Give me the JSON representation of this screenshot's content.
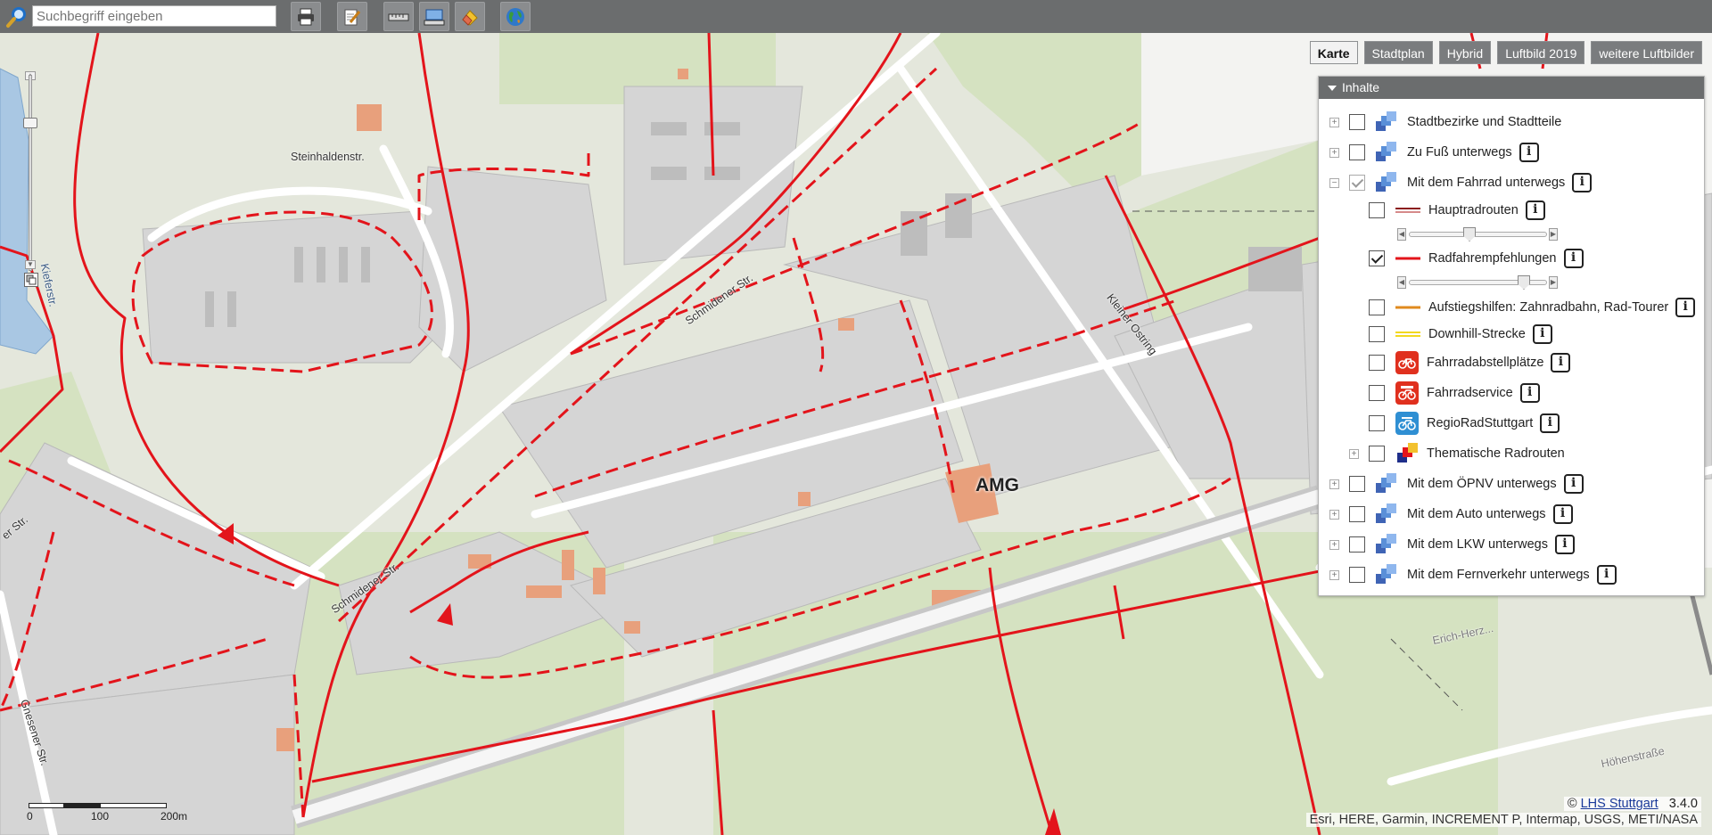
{
  "search": {
    "placeholder": "Suchbegriff eingeben"
  },
  "toolbar": {
    "buttons": [
      {
        "icon": "print-icon"
      },
      {
        "icon": "edit-icon"
      },
      {
        "icon": "measure-distance-icon"
      },
      {
        "icon": "measure-area-icon"
      },
      {
        "icon": "eraser-icon"
      },
      {
        "icon": "globe-icon"
      }
    ]
  },
  "basemaps": {
    "items": [
      "Karte",
      "Stadtplan",
      "Hybrid",
      "Luftbild 2019",
      "weitere Luftbilder"
    ],
    "active": "Karte"
  },
  "panel": {
    "title": "Inhalte",
    "layers": [
      {
        "label": "Stadtbezirke und Stadtteile",
        "checked": false,
        "expand": "+",
        "info": false
      },
      {
        "label": "Zu Fuß unterwegs",
        "checked": false,
        "expand": "+",
        "info": true
      },
      {
        "label": "Mit dem Fahrrad unterwegs",
        "checked": true,
        "expand": "−",
        "info": true
      },
      {
        "label": "Hauptradrouten",
        "checked": false,
        "info": true,
        "slider": 0.5
      },
      {
        "label": "Radfahrempfehlungen",
        "checked": true,
        "info": true,
        "slider": 0.8
      },
      {
        "label": "Aufstiegshilfen: Zahnradbahn, Rad-Tourer",
        "checked": false,
        "info": true
      },
      {
        "label": "Downhill-Strecke",
        "checked": false,
        "info": true
      },
      {
        "label": "Fahrradabstellplätze",
        "checked": false,
        "info": true
      },
      {
        "label": "Fahrradservice",
        "checked": false,
        "info": true
      },
      {
        "label": "RegioRadStuttgart",
        "checked": false,
        "info": true
      },
      {
        "label": "Thematische Radrouten",
        "checked": false,
        "expand": "+",
        "info": false
      },
      {
        "label": "Mit dem ÖPNV unterwegs",
        "checked": false,
        "expand": "+",
        "info": true
      },
      {
        "label": "Mit dem Auto unterwegs",
        "checked": false,
        "expand": "+",
        "info": true
      },
      {
        "label": "Mit dem LKW unterwegs",
        "checked": false,
        "expand": "+",
        "info": true
      },
      {
        "label": "Mit dem Fernverkehr unterwegs",
        "checked": false,
        "expand": "+",
        "info": true
      }
    ],
    "info_glyph": "i"
  },
  "map": {
    "streets": {
      "steinhalden": "Steinhaldenstr.",
      "schmidener_top": "Schmidener Str.",
      "schmidener_bottom": "Schmidener Str.",
      "kleiner_ostring": "Kleiner Ostring",
      "gnesener": "Gnesener Str.",
      "erich": "Erich-Herz...",
      "hoehen": "Höhenstraße",
      "left_edge": "er Str.",
      "kiefer": "Kieferstr."
    },
    "poi": "AMG",
    "colors": {
      "route": "#e3141b",
      "water": "#a8c6e0",
      "green": "#d7e4c4",
      "block": "#d9d9d9"
    }
  },
  "scale": {
    "labels": [
      "0",
      "100",
      "200m"
    ]
  },
  "credit": {
    "prefix": "©",
    "link": "LHS Stuttgart",
    "version": "3.4.0"
  },
  "attribution": "Esri, HERE, Garmin, INCREMENT P, Intermap, USGS, METI/NASA"
}
